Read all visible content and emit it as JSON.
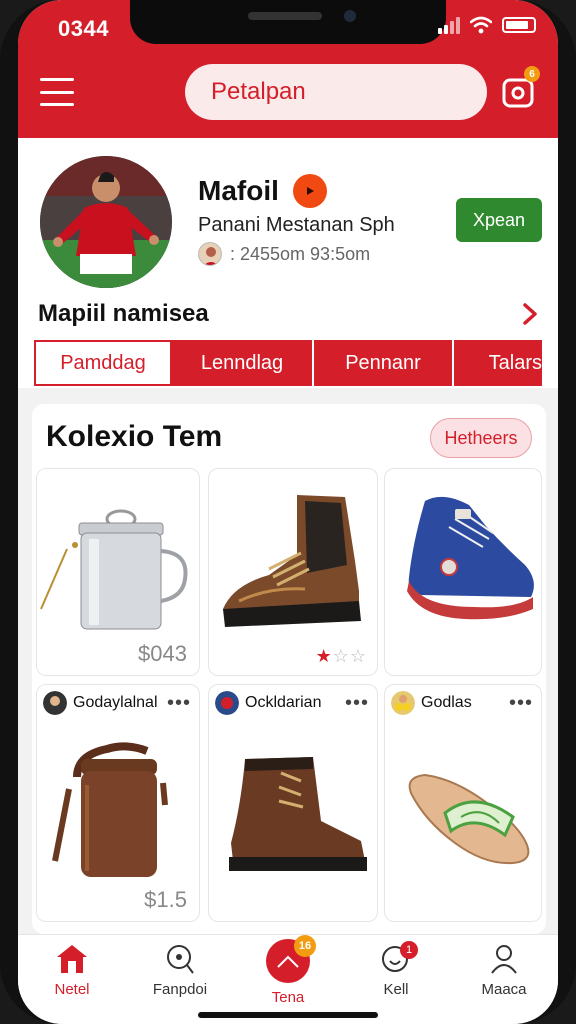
{
  "status_bar": {
    "time": "0344"
  },
  "header": {
    "search": {
      "placeholder": "Petalpan"
    },
    "cart_badge": "6"
  },
  "profile": {
    "name": "Mafoil",
    "subtitle": "Panani Mestanan Sph",
    "meta": ": 2455om 93:5om",
    "action_label": "Xpean",
    "section_label": "Mapiil namisea"
  },
  "tabs": [
    {
      "label": "Pamddag",
      "active": true
    },
    {
      "label": "Lenndlag",
      "active": false
    },
    {
      "label": "Pennanr",
      "active": false
    },
    {
      "label": "Talars",
      "active": false
    }
  ],
  "collection": {
    "title": "Kolexio Tem",
    "filter_label": "Hetheers",
    "items": [
      {
        "name": "canteen",
        "price": "$043"
      },
      {
        "name": "boot",
        "rating": 1,
        "max_rating": 3
      },
      {
        "name": "sneaker"
      },
      {
        "name": "leather-canteen",
        "seller": "Godaylalnal",
        "price": "$1.5"
      },
      {
        "name": "work-boot",
        "seller": "Ockldarian"
      },
      {
        "name": "sandal",
        "seller": "Godlas"
      }
    ]
  },
  "bottom_nav": [
    {
      "label": "Netel",
      "icon": "home-icon",
      "active": true
    },
    {
      "label": "Fanpdoi",
      "icon": "search-icon",
      "active": false
    },
    {
      "label": "Tena",
      "icon": "fab-icon",
      "active": true,
      "badge": "16"
    },
    {
      "label": "Kell",
      "icon": "bell-icon",
      "active": false,
      "badge": "1"
    },
    {
      "label": "Maaca",
      "icon": "profile-icon",
      "active": false
    }
  ],
  "colors": {
    "brand": "#d41f2a",
    "accent": "#2f8a2f",
    "badge": "#f39c12"
  }
}
